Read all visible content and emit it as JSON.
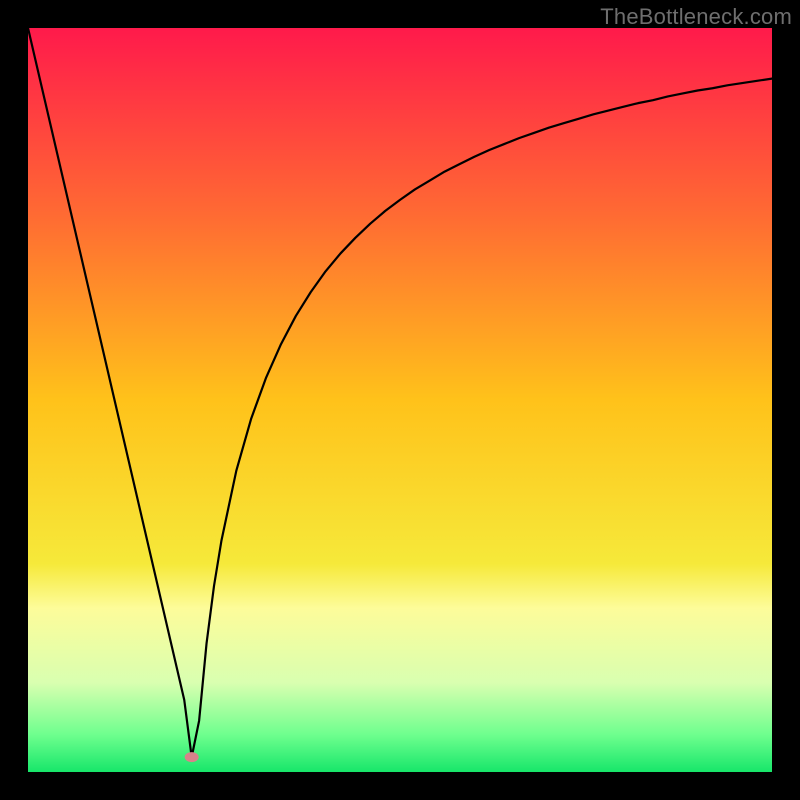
{
  "watermark": "TheBottleneck.com",
  "chart_data": {
    "type": "line",
    "title": "",
    "xlabel": "",
    "ylabel": "",
    "xlim": [
      0,
      100
    ],
    "ylim": [
      0,
      100
    ],
    "marker": {
      "x": 22,
      "y": 2,
      "color": "#d9828a"
    },
    "gradient_stops": [
      {
        "offset": 0.0,
        "color": "#ff1a4b"
      },
      {
        "offset": 0.25,
        "color": "#ff6a33"
      },
      {
        "offset": 0.5,
        "color": "#ffc21a"
      },
      {
        "offset": 0.72,
        "color": "#f6e93a"
      },
      {
        "offset": 0.78,
        "color": "#fdfc9a"
      },
      {
        "offset": 0.88,
        "color": "#d9ffb0"
      },
      {
        "offset": 0.95,
        "color": "#6eff8e"
      },
      {
        "offset": 1.0,
        "color": "#17e66a"
      }
    ],
    "series": [
      {
        "name": "curve",
        "x": [
          0,
          1,
          2,
          3,
          4,
          5,
          6,
          7,
          8,
          9,
          10,
          11,
          12,
          13,
          14,
          15,
          16,
          17,
          18,
          19,
          20,
          21,
          22,
          23,
          24,
          25,
          26,
          28,
          30,
          32,
          34,
          36,
          38,
          40,
          42,
          44,
          46,
          48,
          50,
          52,
          54,
          56,
          58,
          60,
          62,
          64,
          66,
          68,
          70,
          72,
          74,
          76,
          78,
          80,
          82,
          84,
          86,
          88,
          90,
          92,
          94,
          96,
          98,
          100
        ],
        "y": [
          100,
          95.7,
          91.4,
          87.1,
          82.8,
          78.5,
          74.2,
          69.9,
          65.6,
          61.3,
          57.0,
          52.7,
          48.4,
          44.1,
          39.8,
          35.5,
          31.2,
          26.9,
          22.6,
          18.3,
          14.0,
          9.7,
          2.0,
          6.9,
          17.3,
          25.0,
          31.1,
          40.5,
          47.5,
          53.0,
          57.5,
          61.3,
          64.5,
          67.3,
          69.7,
          71.8,
          73.7,
          75.4,
          76.9,
          78.3,
          79.5,
          80.7,
          81.7,
          82.7,
          83.6,
          84.4,
          85.2,
          85.9,
          86.6,
          87.2,
          87.8,
          88.4,
          88.9,
          89.4,
          89.9,
          90.3,
          90.8,
          91.2,
          91.6,
          91.9,
          92.3,
          92.6,
          92.9,
          93.2
        ]
      }
    ]
  }
}
